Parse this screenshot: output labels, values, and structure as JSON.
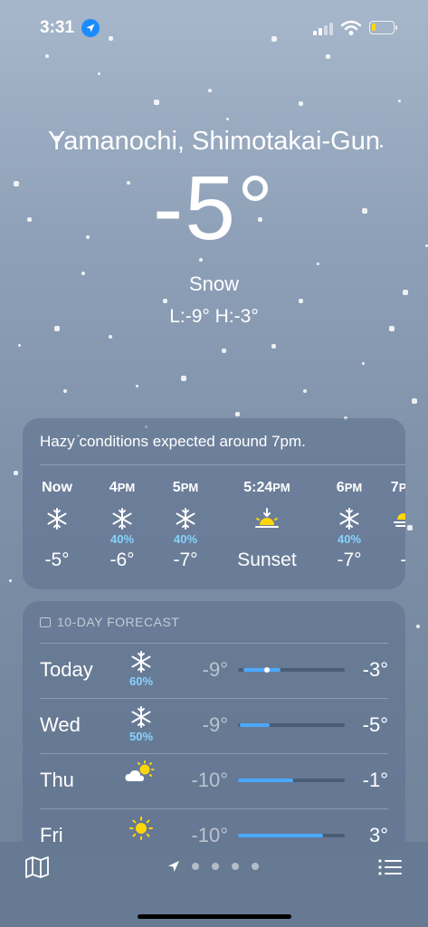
{
  "status_bar": {
    "time": "3:31",
    "icons": [
      "location-arrow-icon",
      "cellular-signal-icon",
      "wifi-icon",
      "battery-low-icon"
    ]
  },
  "location": {
    "city": "Yamanochi, Shimotakai-Gun",
    "temperature": "-5°",
    "condition": "Snow",
    "hilo": "L:-9° H:-3°"
  },
  "hourly": {
    "summary": "Hazy conditions expected around 7pm.",
    "items": [
      {
        "time": "Now",
        "period": "",
        "icon": "snowflake-icon",
        "pop": "",
        "temp": "-5°"
      },
      {
        "time": "4",
        "period": "PM",
        "icon": "snowflake-icon",
        "pop": "40%",
        "temp": "-6°"
      },
      {
        "time": "5",
        "period": "PM",
        "icon": "snowflake-icon",
        "pop": "40%",
        "temp": "-7°"
      },
      {
        "time": "5:24",
        "period": "PM",
        "icon": "sunset-icon",
        "pop": "",
        "temp": "Sunset"
      },
      {
        "time": "6",
        "period": "PM",
        "icon": "snowflake-icon",
        "pop": "40%",
        "temp": "-7°"
      },
      {
        "time": "7",
        "period": "PM",
        "icon": "haze-icon",
        "pop": "",
        "temp": "-"
      }
    ]
  },
  "daily": {
    "header": "10-DAY FORECAST",
    "header_icon": "calendar-icon",
    "days": [
      {
        "day": "Today",
        "icon": "snowflake-icon",
        "pop": "60%",
        "lo": "-9°",
        "hi": "-3°",
        "range_start": 0.05,
        "range_end": 0.4,
        "current": 0.27
      },
      {
        "day": "Wed",
        "icon": "snowflake-icon",
        "pop": "50%",
        "lo": "-9°",
        "hi": "-5°",
        "range_start": 0.02,
        "range_end": 0.3
      },
      {
        "day": "Thu",
        "icon": "partly-sunny-icon",
        "pop": "",
        "lo": "-10°",
        "hi": "-1°",
        "range_start": 0.0,
        "range_end": 0.52
      },
      {
        "day": "Fri",
        "icon": "sun-icon",
        "pop": "",
        "lo": "-10°",
        "hi": "3°",
        "range_start": 0.0,
        "range_end": 0.8
      }
    ]
  },
  "bottom_bar": {
    "icons": [
      "map-icon",
      "location-arrow-icon",
      "list-icon"
    ],
    "page_count": 5,
    "active_page": 0
  },
  "colors": {
    "accent_blue": "#4aa8ff",
    "precip_blue": "#86d3ff",
    "sun_yellow": "#ffd60a",
    "location_pill": "#1a8cff"
  }
}
